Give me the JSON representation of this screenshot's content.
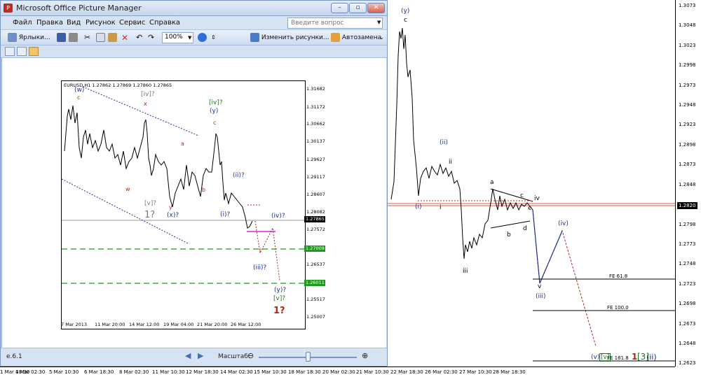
{
  "colors": {
    "wave_blue": "#1f2f8f",
    "wave_red": "#b3261e",
    "wave_green": "#1d7a1d",
    "wave_gray": "#7a7a7a",
    "dash_green": "#1d9a1d",
    "target_red": "#c0392b"
  },
  "mt_chart": {
    "price_ticks": [
      "1.3073",
      "1.3048",
      "1.3023",
      "1.2998",
      "1.2973",
      "1.2948",
      "1.2923",
      "1.2898",
      "1.2873",
      "1.2848",
      "1.2820",
      "1.2798",
      "1.2773",
      "1.2748",
      "1.2723",
      "1.2698",
      "1.2673",
      "1.2648",
      "1.2623"
    ],
    "current_price": "1.2820",
    "time_ticks": [
      "1 Mar 18:30",
      "4 Mar 02:30",
      "5 Mar 10:30",
      "6 Mar 18:30",
      "8 Mar 02:30",
      "11 Mar 10:30",
      "12 Mar 18:30",
      "14 Mar 02:30",
      "15 Mar 10:30",
      "18 Mar 18:30",
      "20 Mar 02:30",
      "21 Mar 10:30",
      "22 Mar 18:30",
      "26 Mar 02:30",
      "27 Mar 10:30",
      "28 Mar 18:30"
    ],
    "labels": {
      "y_top": "(y)",
      "c_top": "c",
      "ii_blue": "(ii)",
      "ii_small": "ii",
      "i_blue": "(i)",
      "i_small": "i",
      "iii_small": "iii",
      "a": "a",
      "b": "b",
      "c": "c",
      "d": "d",
      "e": "e",
      "iv": "iv",
      "iv_blue": "(iv)",
      "v": "v",
      "iii_blue": "(iii)"
    },
    "fe_levels": [
      "FE 61.8",
      "FE 100.0",
      "FE 161.8"
    ],
    "bottom_labels": {
      "v_paren": "(v)",
      "v_bracket": "[v]",
      "fe": "FE 161.8",
      "one": "1",
      "three": "[3]",
      "ii": "(ii)"
    }
  },
  "window": {
    "title": "Microsoft Office Picture Manager",
    "menu": [
      "Файл",
      "Правка",
      "Вид",
      "Рисунок",
      "Сервис",
      "Справка"
    ],
    "search_placeholder": "Введите вопрос",
    "toolbar": {
      "shortcuts": "Ярлыки...",
      "zoom": "100%",
      "edit_pictures": "Изменить рисунки...",
      "autofix": "Автозамена"
    },
    "status": {
      "version": "e.6.1",
      "zoom_label": "Масштаб:"
    }
  },
  "inner_chart": {
    "header": "EURUSD,H1  1.27862 1.27869 1.27860 1.27865",
    "price_ticks": [
      "1.31682",
      "1.31172",
      "1.30662",
      "1.30137",
      "1.29627",
      "1.29117",
      "1.28607",
      "1.28082",
      "1.27572",
      "1.27062",
      "1.26537",
      "1.26027",
      "1.25517",
      "1.25007"
    ],
    "price_current": "1.27865",
    "price_green1": "1.27009",
    "price_green2": "1.26011",
    "time_ticks": [
      "7 Mar 2013",
      "11 Mar 20:00",
      "14 Mar 12:00",
      "19 Mar 04:00",
      "21 Mar 20:00",
      "26 Mar 12:00"
    ],
    "labels": {
      "w_top": "(w)",
      "c_red": "c",
      "iv_q": "[iv]?",
      "x": "x",
      "iv_green": "[iv]?",
      "y": "(y)",
      "c2": "c",
      "a": "a",
      "w": "w",
      "b": "b",
      "ii_q": "(ii)?",
      "v_q": "[v]?",
      "one_q": "1?",
      "y_small": "y",
      "x_q": "(x)?",
      "i_q": "(i)?",
      "iv_q2": "(iv)?",
      "iii_q": "(iii)?",
      "i_small": "i",
      "y_q": "(y)?",
      "v_green": "[v]?",
      "one_red": "1?"
    }
  }
}
